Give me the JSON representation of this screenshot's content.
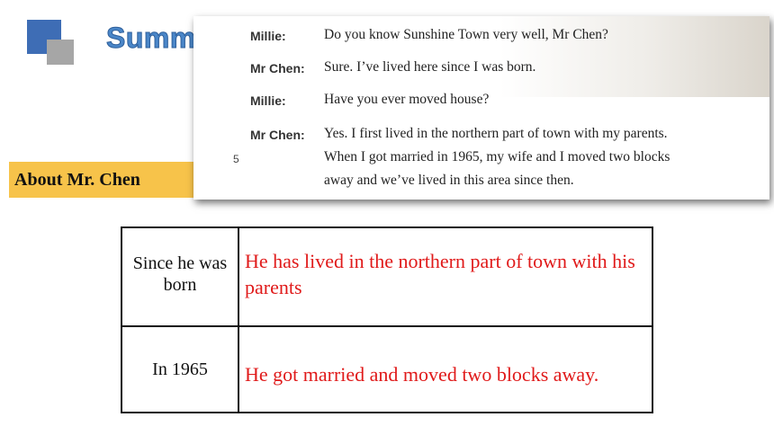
{
  "header": {
    "title": "Summ"
  },
  "section_label": "About Mr. Chen",
  "dialogue": {
    "lines": [
      {
        "speaker": "Millie:",
        "text": "Do you know Sunshine Town very well, Mr Chen?"
      },
      {
        "speaker": "Mr Chen:",
        "text": "Sure. I’ve lived here since I was born."
      },
      {
        "speaker": "Millie:",
        "text": "Have you ever moved house?"
      },
      {
        "speaker": "Mr Chen:",
        "text": "Yes. I first lived in the northern part of town with my parents."
      },
      {
        "speaker": "",
        "text": "When I got married in 1965, my wife and I moved two blocks"
      },
      {
        "speaker": "",
        "text": "away and we’ve lived in this area since then."
      }
    ],
    "line_number": "5"
  },
  "table": {
    "rows": [
      {
        "when": "Since he was born",
        "event": "He has lived in the northern part of town with his parents"
      },
      {
        "when": "In 1965",
        "event": "He got married and moved two blocks away."
      }
    ]
  },
  "colors": {
    "accent_blue": "#3e6db5",
    "label_yellow": "#f7c34a",
    "answer_red": "#e01a1a"
  }
}
